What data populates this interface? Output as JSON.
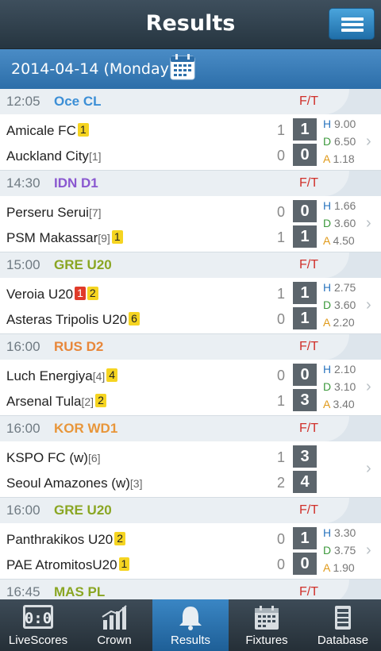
{
  "header": {
    "title": "Results",
    "menu_icon": "menu-icon"
  },
  "datebar": {
    "date": "2014-04-14 (Monday)",
    "icon": "calendar-icon"
  },
  "leagues": [
    {
      "time": "12:05",
      "competition": "Oce CL",
      "color": "#3c8fd6",
      "status": "F/T",
      "home": {
        "name": "Amicale FC",
        "rank": "",
        "yellow": "1",
        "red": ""
      },
      "away": {
        "name": "Auckland City",
        "rank": "[1]",
        "yellow": "",
        "red": ""
      },
      "ht": [
        "1",
        "0"
      ],
      "ft": [
        "1",
        "0"
      ],
      "odds": {
        "h": "9.00",
        "d": "6.50",
        "a": "1.18"
      }
    },
    {
      "time": "14:30",
      "competition": "IDN D1",
      "color": "#8a58d0",
      "status": "F/T",
      "home": {
        "name": "Perseru Serui",
        "rank": "[7]",
        "yellow": "",
        "red": ""
      },
      "away": {
        "name": "PSM Makassar",
        "rank": "[9]",
        "yellow": "1",
        "red": ""
      },
      "ht": [
        "0",
        "1"
      ],
      "ft": [
        "0",
        "1"
      ],
      "odds": {
        "h": "1.66",
        "d": "3.60",
        "a": "4.50"
      }
    },
    {
      "time": "15:00",
      "competition": "GRE U20",
      "color": "#8aa623",
      "status": "F/T",
      "home": {
        "name": "Veroia U20",
        "rank": "",
        "yellow": "2",
        "red": "1"
      },
      "away": {
        "name": "Asteras Tripolis U20",
        "rank": "",
        "yellow": "6",
        "red": ""
      },
      "ht": [
        "1",
        "0"
      ],
      "ft": [
        "1",
        "1"
      ],
      "odds": {
        "h": "2.75",
        "d": "3.60",
        "a": "2.20"
      }
    },
    {
      "time": "16:00",
      "competition": "RUS D2",
      "color": "#e8873a",
      "status": "F/T",
      "home": {
        "name": "Luch Energiya",
        "rank": "[4]",
        "yellow": "4",
        "red": ""
      },
      "away": {
        "name": "Arsenal Tula",
        "rank": "[2]",
        "yellow": "2",
        "red": ""
      },
      "ht": [
        "0",
        "1"
      ],
      "ft": [
        "0",
        "3"
      ],
      "odds": {
        "h": "2.10",
        "d": "3.10",
        "a": "3.40"
      }
    },
    {
      "time": "16:00",
      "competition": "KOR WD1",
      "color": "#e8963a",
      "status": "F/T",
      "home": {
        "name": "KSPO FC (w)",
        "rank": "[6]",
        "yellow": "",
        "red": ""
      },
      "away": {
        "name": "Seoul Amazones (w)",
        "rank": "[3]",
        "yellow": "",
        "red": ""
      },
      "ht": [
        "1",
        "2"
      ],
      "ft": [
        "3",
        "4"
      ],
      "odds": {
        "h": "",
        "d": "",
        "a": ""
      }
    },
    {
      "time": "16:00",
      "competition": "GRE U20",
      "color": "#8aa623",
      "status": "F/T",
      "home": {
        "name": "Panthrakikos U20",
        "rank": "",
        "yellow": "2",
        "red": ""
      },
      "away": {
        "name": "PAE AtromitosU20",
        "rank": "",
        "yellow": "1",
        "red": ""
      },
      "ht": [
        "0",
        "0"
      ],
      "ft": [
        "1",
        "0"
      ],
      "odds": {
        "h": "3.30",
        "d": "3.75",
        "a": "1.90"
      }
    },
    {
      "time": "16:45",
      "competition": "MAS PL",
      "color": "#8aa623",
      "status": "F/T"
    }
  ],
  "odds_labels": {
    "h": "H",
    "d": "D",
    "a": "A"
  },
  "tabs": [
    {
      "label": "LiveScores",
      "icon": "scoreboard-icon"
    },
    {
      "label": "Crown",
      "icon": "bar-chart-icon"
    },
    {
      "label": "Results",
      "icon": "bell-icon",
      "active": true
    },
    {
      "label": "Fixtures",
      "icon": "calendar-icon"
    },
    {
      "label": "Database",
      "icon": "database-icon"
    }
  ],
  "colors": {
    "accent": "#2c6ea9",
    "status": "#d0302a",
    "score_box": "#5c656c"
  }
}
